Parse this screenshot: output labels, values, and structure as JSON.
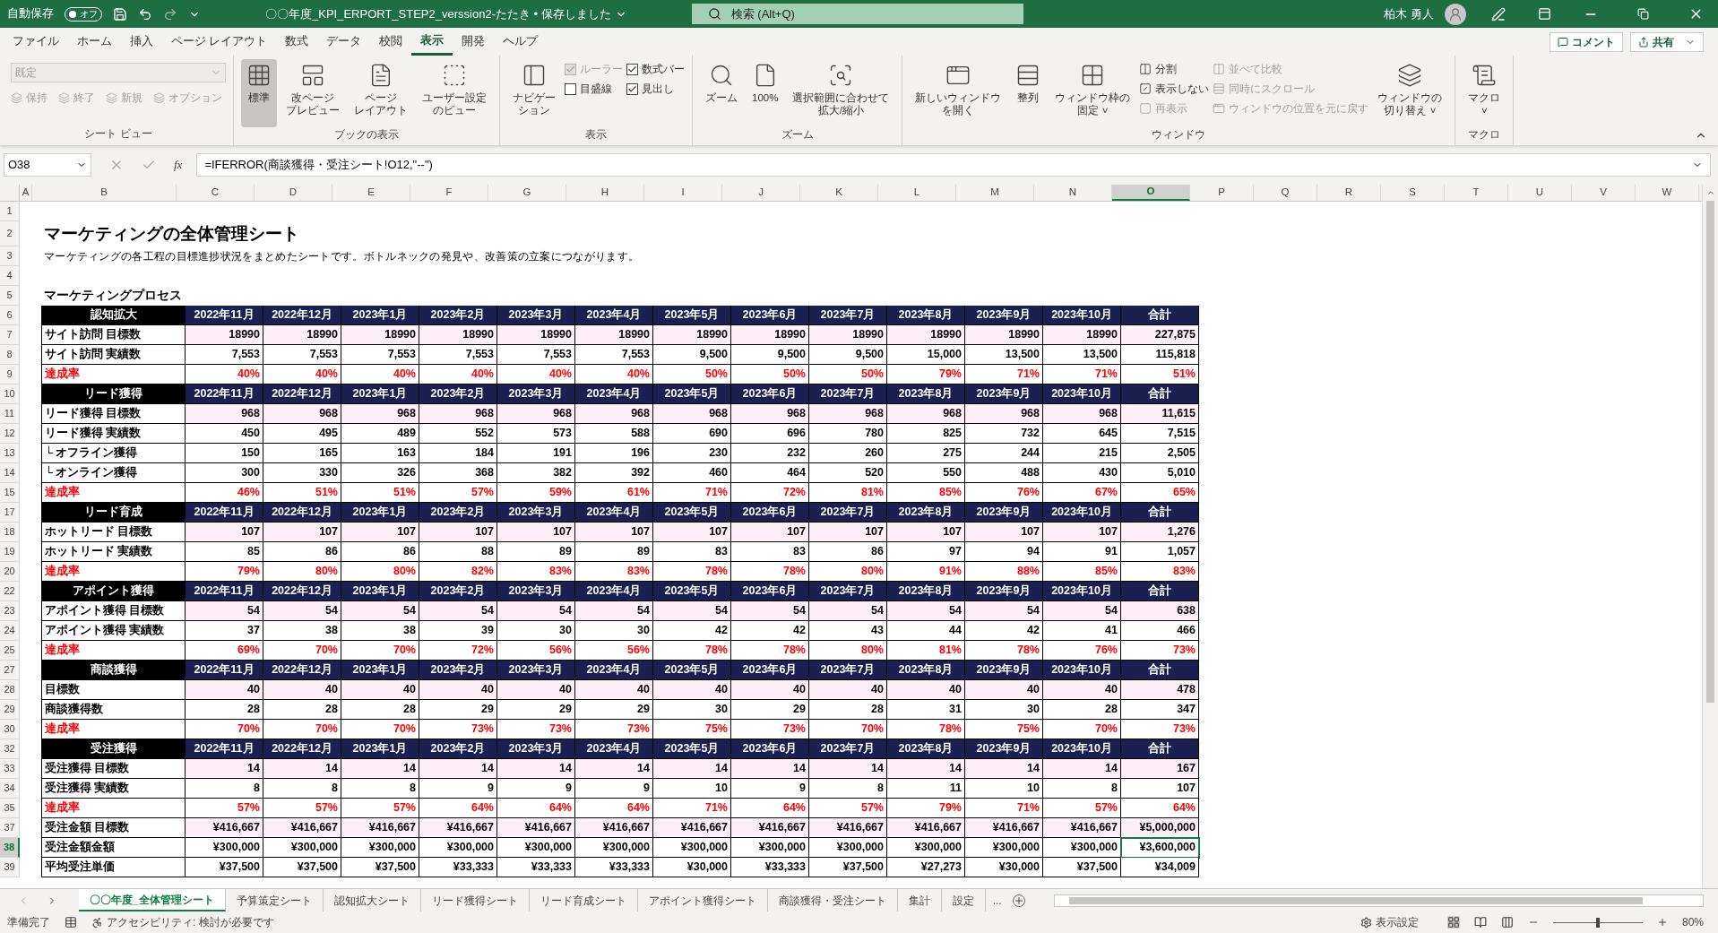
{
  "titlebar": {
    "autosave_label": "自動保存",
    "autosave_state": "オフ",
    "autosave_on": false,
    "title": "〇〇年度_KPI_ERPORT_STEP2_verssion2-たたき • 保存しました",
    "search_placeholder": "検索 (Alt+Q)",
    "user": "柏木 勇人"
  },
  "menu_tabs": [
    {
      "label": "ファイル",
      "selected": false
    },
    {
      "label": "ホーム",
      "selected": false
    },
    {
      "label": "挿入",
      "selected": false
    },
    {
      "label": "ページ レイアウト",
      "selected": false
    },
    {
      "label": "数式",
      "selected": false
    },
    {
      "label": "データ",
      "selected": false
    },
    {
      "label": "校閲",
      "selected": false
    },
    {
      "label": "表示",
      "selected": true
    },
    {
      "label": "開発",
      "selected": false
    },
    {
      "label": "ヘルプ",
      "selected": false
    }
  ],
  "comment_button": "コメント",
  "share_button": "共有",
  "ribbon": {
    "groups": [
      {
        "label": "シート ビュー",
        "columns": [
          [
            {
              "kind": "dropdown",
              "label": "既定",
              "disabled": true
            },
            {
              "kind": "smallrow",
              "disabled": true,
              "labels": [
                "保持",
                "終了",
                "新規",
                "オプション"
              ]
            }
          ]
        ]
      },
      {
        "label": "ブックの表示",
        "columns": [
          [
            {
              "kind": "large",
              "label": "標準",
              "selected": true
            }
          ],
          [
            {
              "kind": "large",
              "label": [
                "改ページ",
                "プレビュー"
              ],
              "selected": false
            }
          ],
          [
            {
              "kind": "large",
              "label": [
                "ページ",
                "レイアウト"
              ],
              "selected": false
            }
          ],
          [
            {
              "kind": "large",
              "label": [
                "ユーザー設定",
                "のビュー"
              ],
              "selected": false
            }
          ]
        ]
      },
      {
        "label": "表示",
        "columns": [
          [
            {
              "kind": "large",
              "label": [
                "ナビゲー",
                "ション"
              ],
              "selected": false
            }
          ],
          [
            {
              "kind": "check",
              "label": "ルーラー",
              "checked": true,
              "disabled": true
            },
            {
              "kind": "check",
              "label": "目盛線",
              "checked": false,
              "disabled": false
            }
          ],
          [
            {
              "kind": "check",
              "label": "数式バー",
              "checked": true,
              "disabled": false
            },
            {
              "kind": "check",
              "label": "見出し",
              "checked": true,
              "disabled": false
            }
          ]
        ]
      },
      {
        "label": "ズーム",
        "columns": [
          [
            {
              "kind": "large",
              "label": "ズーム",
              "selected": false
            }
          ],
          [
            {
              "kind": "large",
              "label": "100%",
              "selected": false
            }
          ],
          [
            {
              "kind": "large",
              "label": [
                "選択範囲に合わせて",
                "拡大/縮小"
              ],
              "selected": false
            }
          ]
        ]
      },
      {
        "label": "ウィンドウ",
        "columns": [
          [
            {
              "kind": "large",
              "label": [
                "新しいウィンドウ",
                "を開く"
              ],
              "selected": false
            }
          ],
          [
            {
              "kind": "large",
              "label": "整列",
              "selected": false
            }
          ],
          [
            {
              "kind": "large",
              "label": [
                "ウィンドウ枠の",
                "固定 ˅"
              ],
              "selected": false
            }
          ],
          [
            {
              "kind": "small",
              "label": "分割",
              "disabled": false
            },
            {
              "kind": "small",
              "label": "表示しない",
              "disabled": false
            },
            {
              "kind": "small",
              "label": "再表示",
              "disabled": true
            }
          ],
          [
            {
              "kind": "small",
              "label": "並べて比較",
              "disabled": true
            },
            {
              "kind": "small",
              "label": "同時にスクロール",
              "disabled": true
            },
            {
              "kind": "small",
              "label": "ウィンドウの位置を元に戻す",
              "disabled": true
            }
          ],
          [
            {
              "kind": "large",
              "label": [
                "ウィンドウの",
                "切り替え ˅"
              ],
              "selected": false
            }
          ]
        ]
      },
      {
        "label": "マクロ",
        "columns": [
          [
            {
              "kind": "large",
              "label": [
                "マクロ",
                "˅"
              ],
              "selected": false
            }
          ]
        ]
      }
    ]
  },
  "formula_bar": {
    "name_box": "O38",
    "function_label": "fx",
    "formula": "=IFERROR(商談獲得・受注シート!O12,\"--\")"
  },
  "columns": [
    {
      "label": "A",
      "selected": false
    },
    {
      "label": "B",
      "selected": false
    },
    {
      "label": "C",
      "selected": false
    },
    {
      "label": "D",
      "selected": false
    },
    {
      "label": "E",
      "selected": false
    },
    {
      "label": "F",
      "selected": false
    },
    {
      "label": "G",
      "selected": false
    },
    {
      "label": "H",
      "selected": false
    },
    {
      "label": "I",
      "selected": false
    },
    {
      "label": "J",
      "selected": false
    },
    {
      "label": "K",
      "selected": false
    },
    {
      "label": "L",
      "selected": false
    },
    {
      "label": "M",
      "selected": false
    },
    {
      "label": "N",
      "selected": false
    },
    {
      "label": "O",
      "selected": true
    },
    {
      "label": "P",
      "selected": false
    },
    {
      "label": "Q",
      "selected": false
    },
    {
      "label": "R",
      "selected": false
    },
    {
      "label": "S",
      "selected": false
    },
    {
      "label": "T",
      "selected": false
    },
    {
      "label": "U",
      "selected": false
    },
    {
      "label": "V",
      "selected": false
    },
    {
      "label": "W",
      "selected": false
    }
  ],
  "rows": [
    {
      "num": "1",
      "kind": "blank",
      "selected": false
    },
    {
      "num": "2",
      "kind": "title",
      "selected": false,
      "text": "マーケティングの全体管理シート"
    },
    {
      "num": "3",
      "kind": "note",
      "selected": false,
      "text": "マーケティングの各工程の目標進捗状況をまとめたシートです。ボトルネックの発見や、改善策の立案につながります。"
    },
    {
      "num": "4",
      "kind": "blank",
      "selected": false
    },
    {
      "num": "5",
      "kind": "heading",
      "selected": false,
      "text": "マーケティングプロセス"
    },
    {
      "num": "6",
      "kind": "header",
      "selected": false,
      "cells": [
        "認知拡大",
        "2022年11月",
        "2022年12月",
        "2023年1月",
        "2023年2月",
        "2023年3月",
        "2023年4月",
        "2023年5月",
        "2023年6月",
        "2023年7月",
        "2023年8月",
        "2023年9月",
        "2023年10月",
        "合計"
      ]
    },
    {
      "num": "7",
      "kind": "target",
      "selected": false,
      "cells": [
        "サイト訪問 目標数",
        "18990",
        "18990",
        "18990",
        "18990",
        "18990",
        "18990",
        "18990",
        "18990",
        "18990",
        "18990",
        "18990",
        "18990",
        "227,875"
      ]
    },
    {
      "num": "8",
      "kind": "actual",
      "selected": false,
      "cells": [
        "サイト訪問 実績数",
        "7,553",
        "7,553",
        "7,553",
        "7,553",
        "7,553",
        "7,553",
        "9,500",
        "9,500",
        "9,500",
        "15,000",
        "13,500",
        "13,500",
        "115,818"
      ]
    },
    {
      "num": "9",
      "kind": "rate",
      "selected": false,
      "cells": [
        "達成率",
        "40%",
        "40%",
        "40%",
        "40%",
        "40%",
        "40%",
        "50%",
        "50%",
        "50%",
        "79%",
        "71%",
        "71%",
        "51%"
      ]
    },
    {
      "num": "10",
      "kind": "header",
      "selected": false,
      "cells": [
        "リード獲得",
        "2022年11月",
        "2022年12月",
        "2023年1月",
        "2023年2月",
        "2023年3月",
        "2023年4月",
        "2023年5月",
        "2023年6月",
        "2023年7月",
        "2023年8月",
        "2023年9月",
        "2023年10月",
        "合計"
      ]
    },
    {
      "num": "11",
      "kind": "target",
      "selected": false,
      "cells": [
        "リード獲得 目標数",
        "968",
        "968",
        "968",
        "968",
        "968",
        "968",
        "968",
        "968",
        "968",
        "968",
        "968",
        "968",
        "11,615"
      ]
    },
    {
      "num": "12",
      "kind": "actual",
      "selected": false,
      "cells": [
        "リード獲得 実績数",
        "450",
        "495",
        "489",
        "552",
        "573",
        "588",
        "690",
        "696",
        "780",
        "825",
        "732",
        "645",
        "7,515"
      ]
    },
    {
      "num": "13",
      "kind": "actual",
      "selected": false,
      "cells": [
        " └ オフライン獲得",
        "150",
        "165",
        "163",
        "184",
        "191",
        "196",
        "230",
        "232",
        "260",
        "275",
        "244",
        "215",
        "2,505"
      ]
    },
    {
      "num": "14",
      "kind": "actual",
      "selected": false,
      "cells": [
        " └ オンライン獲得",
        "300",
        "330",
        "326",
        "368",
        "382",
        "392",
        "460",
        "464",
        "520",
        "550",
        "488",
        "430",
        "5,010"
      ]
    },
    {
      "num": "15",
      "kind": "rate",
      "selected": false,
      "cells": [
        "達成率",
        "46%",
        "51%",
        "51%",
        "57%",
        "59%",
        "61%",
        "71%",
        "72%",
        "81%",
        "85%",
        "76%",
        "67%",
        "65%"
      ]
    },
    {
      "num": "17",
      "kind": "header",
      "selected": false,
      "cells": [
        "リード育成",
        "2022年11月",
        "2022年12月",
        "2023年1月",
        "2023年2月",
        "2023年3月",
        "2023年4月",
        "2023年5月",
        "2023年6月",
        "2023年7月",
        "2023年8月",
        "2023年9月",
        "2023年10月",
        "合計"
      ]
    },
    {
      "num": "18",
      "kind": "target",
      "selected": false,
      "cells": [
        "ホットリード 目標数",
        "107",
        "107",
        "107",
        "107",
        "107",
        "107",
        "107",
        "107",
        "107",
        "107",
        "107",
        "107",
        "1,276"
      ]
    },
    {
      "num": "19",
      "kind": "actual",
      "selected": false,
      "cells": [
        "ホットリード 実績数",
        "85",
        "86",
        "86",
        "88",
        "89",
        "89",
        "83",
        "83",
        "86",
        "97",
        "94",
        "91",
        "1,057"
      ]
    },
    {
      "num": "20",
      "kind": "rate",
      "selected": false,
      "cells": [
        "達成率",
        "79%",
        "80%",
        "80%",
        "82%",
        "83%",
        "83%",
        "78%",
        "78%",
        "80%",
        "91%",
        "88%",
        "85%",
        "83%"
      ]
    },
    {
      "num": "22",
      "kind": "header",
      "selected": false,
      "cells": [
        "アポイント獲得",
        "2022年11月",
        "2022年12月",
        "2023年1月",
        "2023年2月",
        "2023年3月",
        "2023年4月",
        "2023年5月",
        "2023年6月",
        "2023年7月",
        "2023年8月",
        "2023年9月",
        "2023年10月",
        "合計"
      ]
    },
    {
      "num": "23",
      "kind": "target",
      "selected": false,
      "cells": [
        "アポイント獲得 目標数",
        "54",
        "54",
        "54",
        "54",
        "54",
        "54",
        "54",
        "54",
        "54",
        "54",
        "54",
        "54",
        "638"
      ]
    },
    {
      "num": "24",
      "kind": "actual",
      "selected": false,
      "cells": [
        "アポイント獲得 実績数",
        "37",
        "38",
        "38",
        "39",
        "30",
        "30",
        "42",
        "42",
        "43",
        "44",
        "42",
        "41",
        "466"
      ]
    },
    {
      "num": "25",
      "kind": "rate",
      "selected": false,
      "cells": [
        "達成率",
        "69%",
        "70%",
        "70%",
        "72%",
        "56%",
        "56%",
        "78%",
        "78%",
        "80%",
        "81%",
        "78%",
        "76%",
        "73%"
      ]
    },
    {
      "num": "27",
      "kind": "header",
      "selected": false,
      "cells": [
        "商談獲得",
        "2022年11月",
        "2022年12月",
        "2023年1月",
        "2023年2月",
        "2023年3月",
        "2023年4月",
        "2023年5月",
        "2023年6月",
        "2023年7月",
        "2023年8月",
        "2023年9月",
        "2023年10月",
        "合計"
      ]
    },
    {
      "num": "28",
      "kind": "target",
      "selected": false,
      "cells": [
        "目標数",
        "40",
        "40",
        "40",
        "40",
        "40",
        "40",
        "40",
        "40",
        "40",
        "40",
        "40",
        "40",
        "478"
      ]
    },
    {
      "num": "29",
      "kind": "actual",
      "selected": false,
      "cells": [
        "商談獲得数",
        "28",
        "28",
        "28",
        "29",
        "29",
        "29",
        "30",
        "29",
        "28",
        "31",
        "30",
        "28",
        "347"
      ]
    },
    {
      "num": "30",
      "kind": "rate",
      "selected": false,
      "cells": [
        "達成率",
        "70%",
        "70%",
        "70%",
        "73%",
        "73%",
        "73%",
        "75%",
        "73%",
        "70%",
        "78%",
        "75%",
        "70%",
        "73%"
      ]
    },
    {
      "num": "32",
      "kind": "header",
      "selected": false,
      "cells": [
        "受注獲得",
        "2022年11月",
        "2022年12月",
        "2023年1月",
        "2023年2月",
        "2023年3月",
        "2023年4月",
        "2023年5月",
        "2023年6月",
        "2023年7月",
        "2023年8月",
        "2023年9月",
        "2023年10月",
        "合計"
      ]
    },
    {
      "num": "33",
      "kind": "target",
      "selected": false,
      "cells": [
        "受注獲得 目標数",
        "14",
        "14",
        "14",
        "14",
        "14",
        "14",
        "14",
        "14",
        "14",
        "14",
        "14",
        "14",
        "167"
      ]
    },
    {
      "num": "34",
      "kind": "actual",
      "selected": false,
      "cells": [
        "受注獲得 実績数",
        "8",
        "8",
        "8",
        "9",
        "9",
        "9",
        "10",
        "9",
        "8",
        "11",
        "10",
        "8",
        "107"
      ]
    },
    {
      "num": "35",
      "kind": "rate",
      "selected": false,
      "cells": [
        "達成率",
        "57%",
        "57%",
        "57%",
        "64%",
        "64%",
        "64%",
        "71%",
        "64%",
        "57%",
        "79%",
        "71%",
        "57%",
        "64%"
      ]
    },
    {
      "num": "37",
      "kind": "target",
      "selected": false,
      "cells": [
        "受注金額 目標数",
        "¥416,667",
        "¥416,667",
        "¥416,667",
        "¥416,667",
        "¥416,667",
        "¥416,667",
        "¥416,667",
        "¥416,667",
        "¥416,667",
        "¥416,667",
        "¥416,667",
        "¥416,667",
        "¥5,000,000"
      ]
    },
    {
      "num": "38",
      "kind": "actual",
      "selected": true,
      "cells": [
        "受注金額金額",
        "¥300,000",
        "¥300,000",
        "¥300,000",
        "¥300,000",
        "¥300,000",
        "¥300,000",
        "¥300,000",
        "¥300,000",
        "¥300,000",
        "¥300,000",
        "¥300,000",
        "¥300,000",
        "¥3,600,000"
      ]
    },
    {
      "num": "39",
      "kind": "actual",
      "selected": false,
      "cells": [
        "平均受注単価",
        "¥37,500",
        "¥37,500",
        "¥37,500",
        "¥33,333",
        "¥33,333",
        "¥33,333",
        "¥30,000",
        "¥33,333",
        "¥37,500",
        "¥27,273",
        "¥30,000",
        "¥37,500",
        "¥34,009"
      ]
    }
  ],
  "sheet_tabs": [
    {
      "label": "〇〇年度_全体管理シート",
      "selected": true
    },
    {
      "label": "予算策定シート",
      "selected": false
    },
    {
      "label": "認知拡大シート",
      "selected": false
    },
    {
      "label": "リード獲得シート",
      "selected": false
    },
    {
      "label": "リード育成シート",
      "selected": false
    },
    {
      "label": "アポイント獲得シート",
      "selected": false
    },
    {
      "label": "商談獲得・受注シート",
      "selected": false
    },
    {
      "label": "集計",
      "selected": false
    },
    {
      "label": "設定",
      "selected": false
    }
  ],
  "more_tabs": "...",
  "status_bar": {
    "ready": "準備完了",
    "accessibility": "アクセシビリティ: 検討が必要です",
    "display_settings": "表示設定",
    "zoom": {
      "level": 0.5,
      "reading": "80%"
    }
  }
}
